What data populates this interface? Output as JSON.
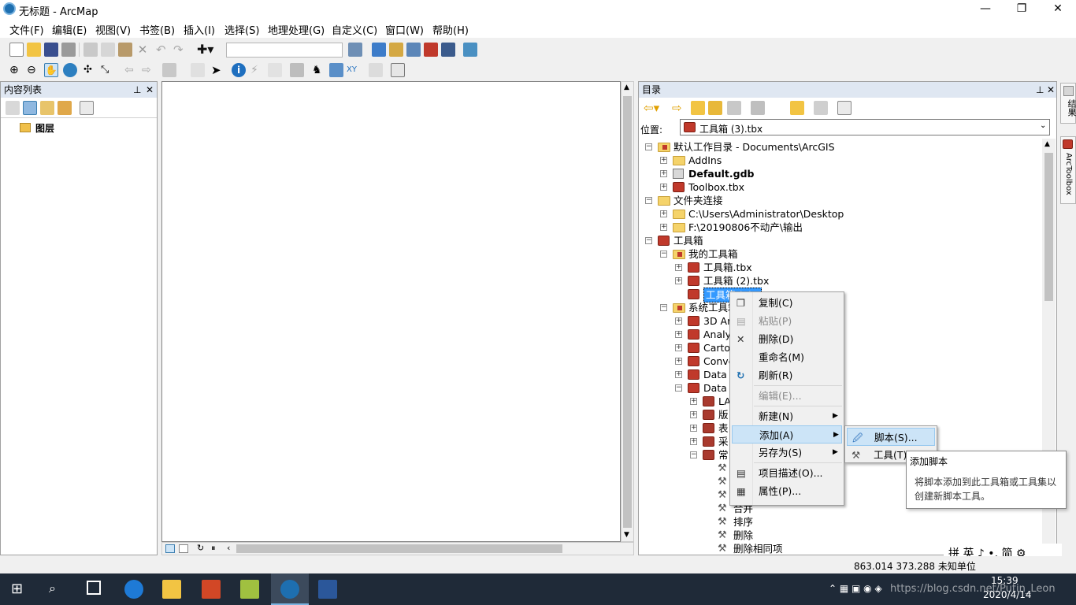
{
  "window": {
    "title": "无标题 - ArcMap",
    "minimize": "—",
    "maximize": "❐",
    "close": "✕"
  },
  "menu": [
    "文件(F)",
    "编辑(E)",
    "视图(V)",
    "书签(B)",
    "插入(I)",
    "选择(S)",
    "地理处理(G)",
    "自定义(C)",
    "窗口(W)",
    "帮助(H)"
  ],
  "toc": {
    "title": "内容列表",
    "layers_label": "图层",
    "pin": "ᵖ",
    "close": "✕"
  },
  "catalog": {
    "title": "目录",
    "location_label": "位置:",
    "location_value": "工具箱 (3).tbx",
    "tree": [
      {
        "label": "默认工作目录 - Documents\\ArcGIS",
        "icon": "folder-home",
        "expander": "−"
      },
      {
        "label": "AddIns",
        "icon": "folder",
        "expander": "+"
      },
      {
        "label": "Default.gdb",
        "icon": "gdb",
        "expander": "+"
      },
      {
        "label": "Toolbox.tbx",
        "icon": "toolbox",
        "expander": "+"
      },
      {
        "label": "文件夹连接",
        "icon": "folder",
        "expander": "−"
      },
      {
        "label": "C:\\Users\\Administrator\\Desktop",
        "icon": "folder",
        "expander": "+"
      },
      {
        "label": "F:\\20190806不动产\\输出",
        "icon": "folder",
        "expander": "+"
      },
      {
        "label": "工具箱",
        "icon": "toolbox",
        "expander": "−"
      },
      {
        "label": "我的工具箱",
        "icon": "folder-toolbox",
        "expander": "−"
      },
      {
        "label": "工具箱.tbx",
        "icon": "toolbox",
        "expander": "+"
      },
      {
        "label": "工具箱 (2).tbx",
        "icon": "toolbox",
        "expander": "+"
      },
      {
        "label": "工具箱 (3).t",
        "icon": "toolbox",
        "expander": ""
      },
      {
        "label": "系统工具箱",
        "icon": "folder-toolbox",
        "expander": "−"
      },
      {
        "label": "3D Ar",
        "icon": "toolbox",
        "expander": "+"
      },
      {
        "label": "Analys",
        "icon": "toolbox",
        "expander": "+"
      },
      {
        "label": "Carto",
        "icon": "toolbox",
        "expander": "+"
      },
      {
        "label": "Conve",
        "icon": "toolbox",
        "expander": "+"
      },
      {
        "label": "Data I",
        "icon": "toolbox",
        "expander": "+"
      },
      {
        "label": "Data I",
        "icon": "toolbox",
        "expander": "−"
      },
      {
        "label": "LA",
        "icon": "toolset",
        "expander": "+"
      },
      {
        "label": "版",
        "icon": "toolset",
        "expander": "+"
      },
      {
        "label": "表",
        "icon": "toolset",
        "expander": "+"
      },
      {
        "label": "采",
        "icon": "toolset",
        "expander": "+"
      },
      {
        "label": "常",
        "icon": "toolset",
        "expander": "−"
      },
      {
        "label": "",
        "icon": "tool",
        "expander": ""
      },
      {
        "label": "",
        "icon": "tool",
        "expander": ""
      },
      {
        "label": "",
        "icon": "tool",
        "expander": ""
      },
      {
        "label": "合并",
        "icon": "tool",
        "expander": ""
      },
      {
        "label": "排序",
        "icon": "tool",
        "expander": ""
      },
      {
        "label": "删除",
        "icon": "tool",
        "expander": ""
      },
      {
        "label": "删除相同项",
        "icon": "tool",
        "expander": ""
      }
    ]
  },
  "context_menu": [
    {
      "label": "复制(C)",
      "icon": "copy-icon",
      "disabled": false
    },
    {
      "label": "粘贴(P)",
      "icon": "paste-icon",
      "disabled": true
    },
    {
      "label": "删除(D)",
      "icon": "delete-icon",
      "disabled": false
    },
    {
      "label": "重命名(M)",
      "icon": "",
      "disabled": false
    },
    {
      "label": "刷新(R)",
      "icon": "refresh-icon",
      "disabled": false
    },
    {
      "label": "编辑(E)...",
      "icon": "",
      "disabled": true
    },
    {
      "label": "新建(N)",
      "icon": "",
      "disabled": false,
      "submenu": true
    },
    {
      "label": "添加(A)",
      "icon": "",
      "disabled": false,
      "submenu": true,
      "highlighted": true
    },
    {
      "label": "另存为(S)",
      "icon": "",
      "disabled": false,
      "submenu": true
    },
    {
      "label": "项目描述(O)...",
      "icon": "description-icon",
      "disabled": false
    },
    {
      "label": "属性(P)...",
      "icon": "properties-icon",
      "disabled": false
    }
  ],
  "submenu": [
    {
      "label": "脚本(S)...",
      "icon": "script-icon",
      "highlighted": true
    },
    {
      "label": "工具(T)...",
      "icon": "hammer-icon"
    }
  ],
  "tooltip": {
    "title": "添加脚本",
    "body_line1": "将脚本添加到此工具箱或工具集以",
    "body_line2": "创建新脚本工具。"
  },
  "side_tabs": [
    "结果",
    "ArcToolbox"
  ],
  "status": {
    "coords": "863.014  373.288 未知单位"
  },
  "ime": {
    "label": "拼 英 ♪ •, 简 ⚙"
  },
  "taskbar": {
    "time": "15:39",
    "date": "2020/4/14",
    "watermark": "https://blog.csdn.net/Putin_Leon"
  },
  "colors": {
    "title_bg": "#dfe7f2",
    "selection": "#3399ff",
    "highlight": "#cce4f7",
    "taskbar": "#1f2a38"
  }
}
